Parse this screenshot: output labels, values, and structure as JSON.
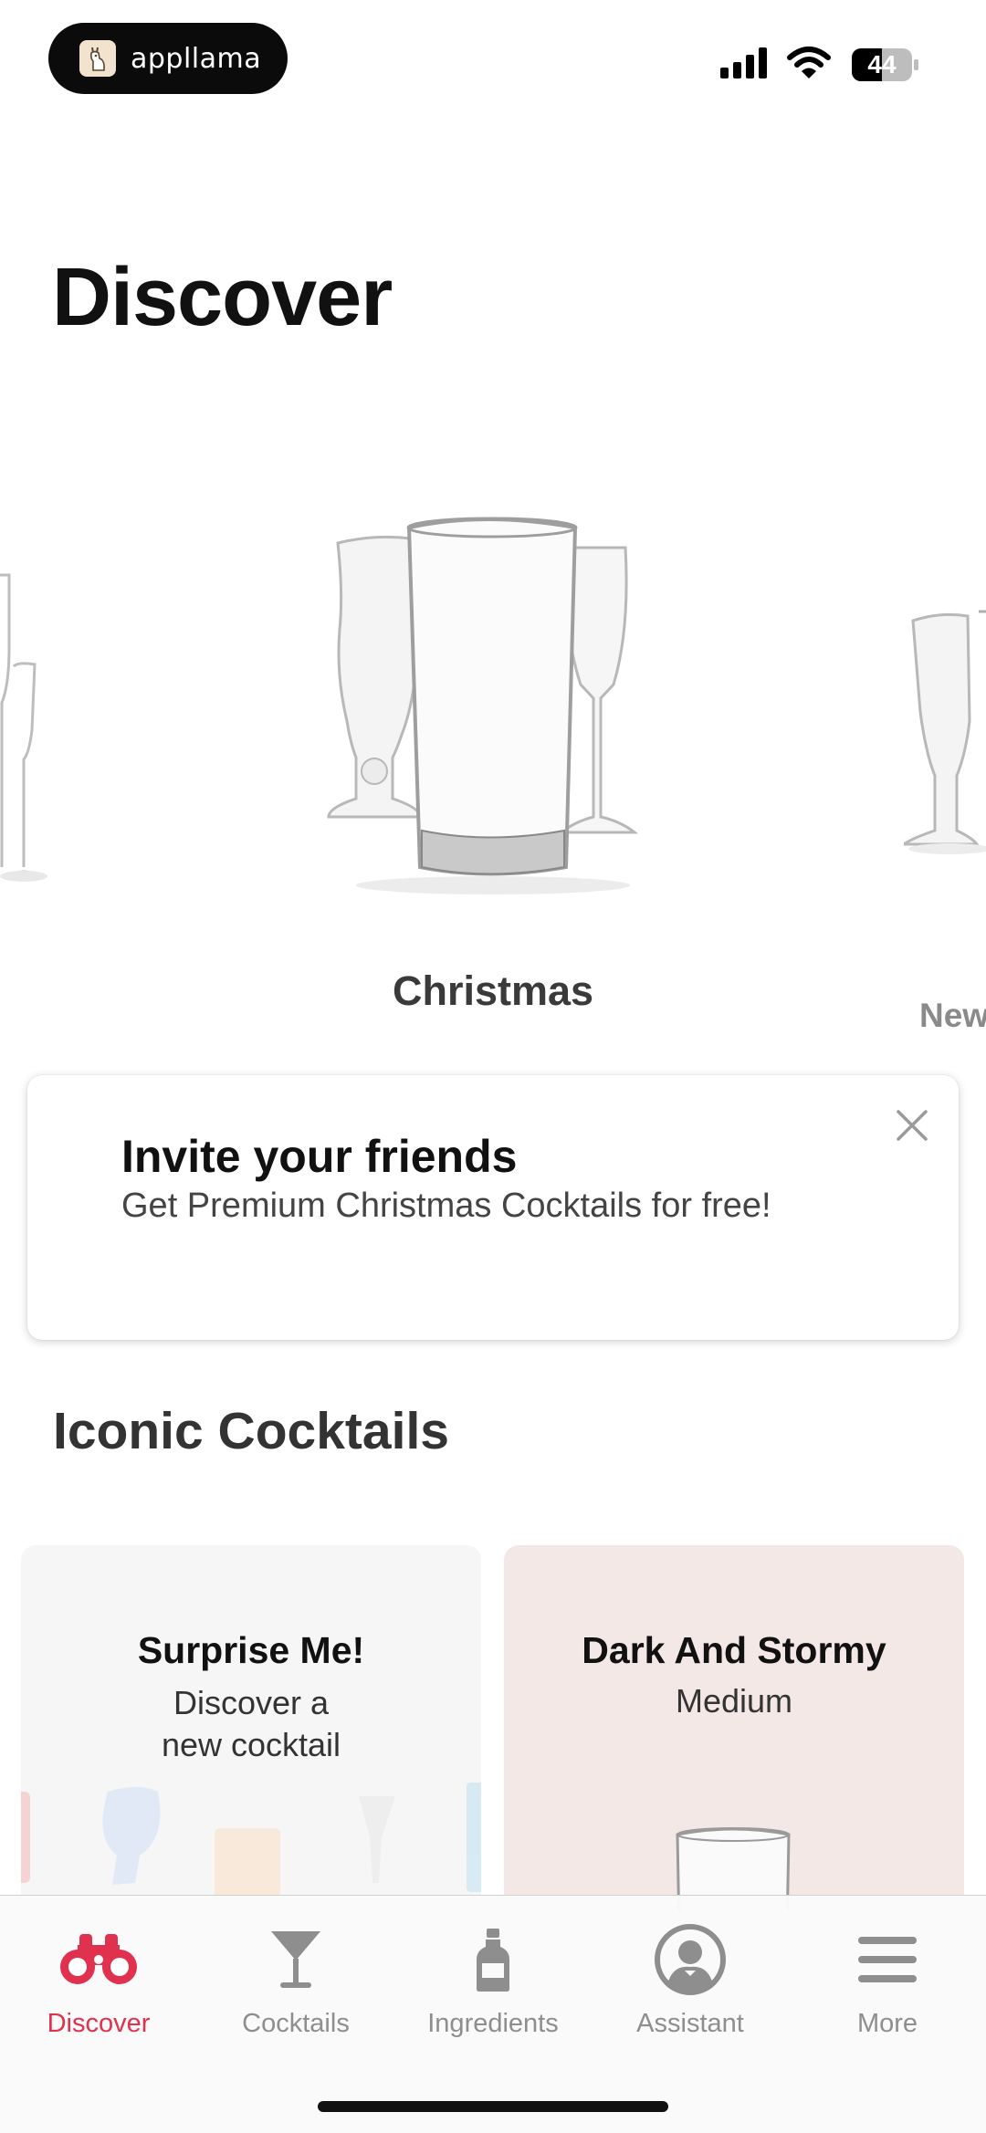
{
  "status_bar": {
    "app_name": "appllama",
    "battery": "44"
  },
  "header": {
    "title": "Discover"
  },
  "carousel": {
    "items": [
      {
        "label": "Christmas"
      },
      {
        "label": "New"
      }
    ]
  },
  "invite_banner": {
    "title": "Invite your friends",
    "subtitle": "Get Premium Christmas Cocktails for free!"
  },
  "iconic_section": {
    "title": "Iconic Cocktails",
    "cards": [
      {
        "title": "Surprise Me!",
        "subtitle": "Discover a new cocktail"
      },
      {
        "title": "Dark And Stormy",
        "subtitle": "Medium"
      }
    ]
  },
  "tab_bar": {
    "tabs": [
      {
        "label": "Discover",
        "icon": "binoculars-icon",
        "active": true
      },
      {
        "label": "Cocktails",
        "icon": "cocktail-glass-icon",
        "active": false
      },
      {
        "label": "Ingredients",
        "icon": "bottle-icon",
        "active": false
      },
      {
        "label": "Assistant",
        "icon": "assistant-avatar-icon",
        "active": false
      },
      {
        "label": "More",
        "icon": "menu-icon",
        "active": false
      }
    ]
  },
  "colors": {
    "accent": "#e0324f",
    "inactive": "#8e8e8e"
  }
}
